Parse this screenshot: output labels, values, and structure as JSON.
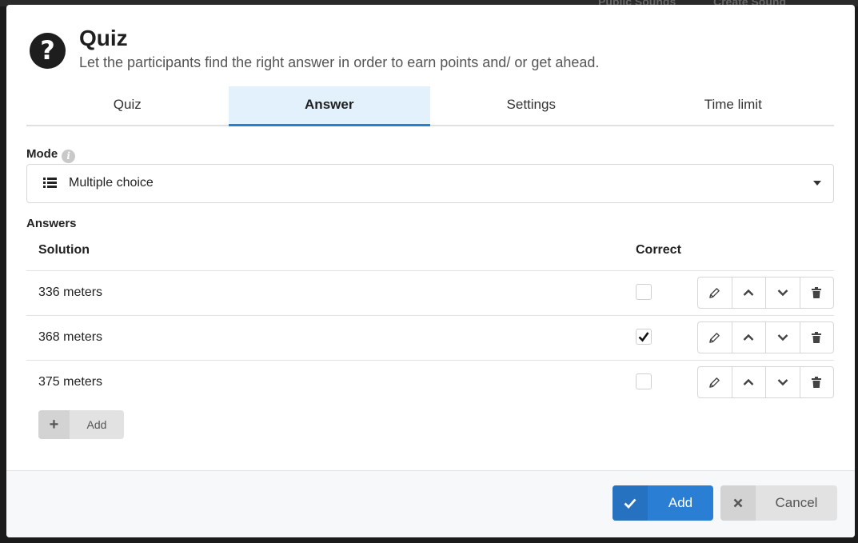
{
  "background": {
    "items": [
      "Public Sounds",
      "Create Sound"
    ]
  },
  "dialog": {
    "title": "Quiz",
    "subtitle": "Let the participants find the right answer in order to earn points and/ or get ahead.",
    "help_icon": "question-circle-icon",
    "help_glyph": "?"
  },
  "tabs": [
    {
      "label": "Quiz",
      "active": false
    },
    {
      "label": "Answer",
      "active": true
    },
    {
      "label": "Settings",
      "active": false
    },
    {
      "label": "Time limit",
      "active": false
    }
  ],
  "mode": {
    "label": "Mode",
    "info_icon": "info-icon",
    "selected": "Multiple choice",
    "selected_icon": "list-icon"
  },
  "answers": {
    "label": "Answers",
    "columns": {
      "solution": "Solution",
      "correct": "Correct"
    },
    "rows": [
      {
        "solution": "336 meters",
        "correct": false
      },
      {
        "solution": "368 meters",
        "correct": true
      },
      {
        "solution": "375 meters",
        "correct": false
      }
    ],
    "row_actions": [
      "pencil-icon",
      "chevron-up-icon",
      "chevron-down-icon",
      "trash-icon"
    ],
    "add_label": "Add"
  },
  "footer": {
    "submit_label": "Add",
    "cancel_label": "Cancel"
  },
  "colors": {
    "accent": "#2a7fd4",
    "active_tab_bg": "#e3f1fc"
  }
}
